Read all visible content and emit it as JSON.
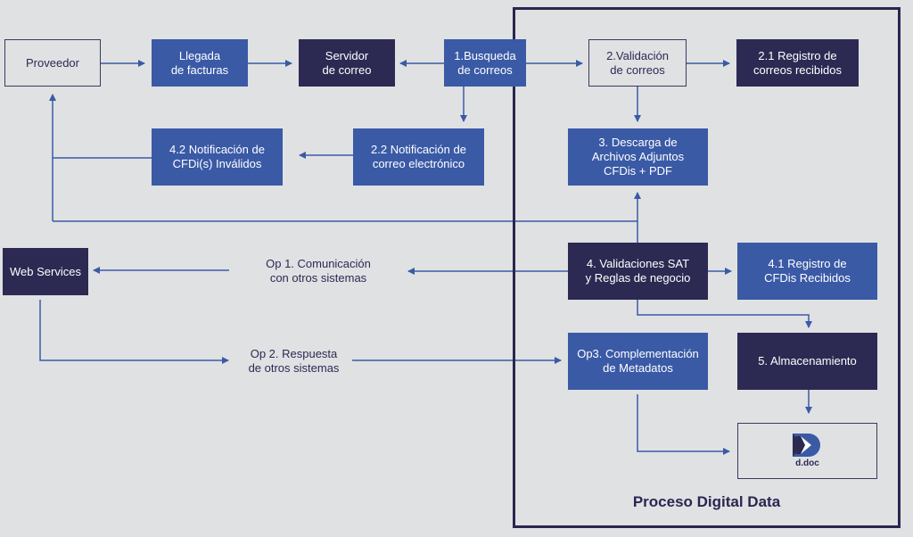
{
  "diagram": {
    "frame_title": "Proceso Digital Data",
    "nodes": {
      "proveedor": "Proveedor",
      "llegada": "Llegada\nde facturas",
      "servidor": "Servidor\nde correo",
      "busqueda": "1.Busqueda\nde correos",
      "validacion": "2.Validación\nde correos",
      "registro_correos": "2.1 Registro de\ncorreos recibidos",
      "notif_cfdi": "4.2 Notificación de\nCFDi(s) Inválidos",
      "notif_correo": "2.2 Notificación de\ncorreo electrónico",
      "descarga": "3. Descarga de\nArchivos Adjuntos\nCFDis + PDF",
      "web_services": "Web Services",
      "validaciones_sat": "4. Validaciones SAT\ny Reglas de negocio",
      "registro_cfdis": "4.1 Registro de\nCFDis Recibidos",
      "complementacion": "Op3. Complementación\nde Metadatos",
      "almacenamiento": "5. Almacenamiento"
    },
    "edge_labels": {
      "op1": "Op 1. Comunicación\ncon otros sistemas",
      "op2": "Op 2. Respuesta\nde otros sistemas"
    },
    "logo": {
      "icon": "ddoc-logo-icon",
      "text": "d.doc"
    },
    "colors": {
      "background": "#e0e1e3",
      "blue": "#3a5aa6",
      "navy": "#2c2a52",
      "connector": "#3a5aa6"
    }
  }
}
